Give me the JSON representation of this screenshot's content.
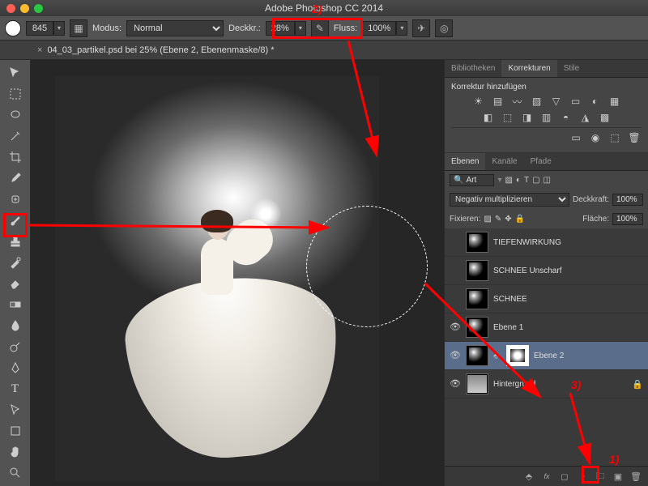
{
  "app_title": "Adobe Photoshop CC 2014",
  "document_tab": "04_03_partikel.psd bei 25% (Ebene 2, Ebenenmaske/8) *",
  "optbar": {
    "brush_size": "845",
    "mode_label": "Modus:",
    "mode_value": "Normal",
    "opacity_label": "Deckkr.:",
    "opacity_value": "28%",
    "flow_label": "Fluss:",
    "flow_value": "100%"
  },
  "panel_tabs": {
    "lib": "Bibliotheken",
    "adjust": "Korrekturen",
    "styles": "Stile"
  },
  "adjustments_title": "Korrektur hinzufügen",
  "layer_tabs": {
    "layers": "Ebenen",
    "channels": "Kanäle",
    "paths": "Pfade"
  },
  "layer_panel": {
    "filter_label": "Art",
    "blend_mode": "Negativ multiplizieren",
    "opacity_label": "Deckkraft:",
    "opacity_value": "100%",
    "lock_label": "Fixieren:",
    "fill_label": "Fläche:",
    "fill_value": "100%"
  },
  "layers": [
    {
      "name": "TIEFENWIRKUNG",
      "visible": false
    },
    {
      "name": "SCHNEE Unscharf",
      "visible": false
    },
    {
      "name": "SCHNEE",
      "visible": false
    },
    {
      "name": "Ebene 1",
      "visible": true
    },
    {
      "name": "Ebene 2",
      "visible": true,
      "selected": true,
      "mask": true
    },
    {
      "name": "Hintergrund",
      "visible": true,
      "bg": true
    }
  ],
  "annotations": {
    "n1": "1)",
    "n2": "2)",
    "n3": "3)"
  }
}
